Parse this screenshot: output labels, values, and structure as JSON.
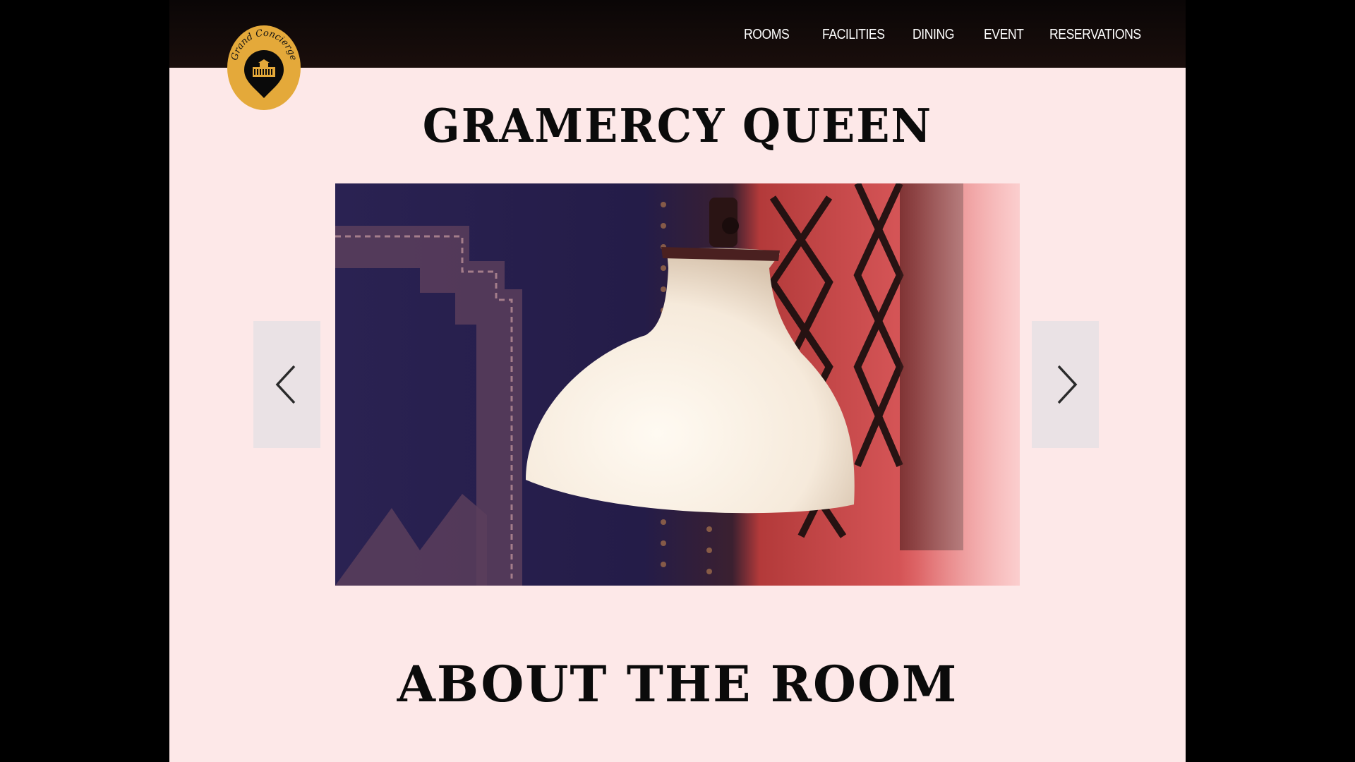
{
  "nav": {
    "items": [
      {
        "label": "ROOMS"
      },
      {
        "label": "FACILITIES"
      },
      {
        "label": "DINING"
      },
      {
        "label": "EVENT"
      },
      {
        "label": "RESERVATIONS"
      }
    ]
  },
  "logo": {
    "text": "Grand Concierge",
    "color": "#e4a93a"
  },
  "room": {
    "title": "GRAMERCY QUEEN"
  },
  "gallery": {
    "image": "lamp-photo",
    "prev_icon": "chevron-left-icon",
    "next_icon": "chevron-right-icon"
  },
  "about": {
    "title": "ABOUT THE ROOM"
  },
  "colors": {
    "page_bg": "#fde8e8",
    "nav_bg": "#0f0908",
    "logo_gold": "#e4a93a"
  }
}
